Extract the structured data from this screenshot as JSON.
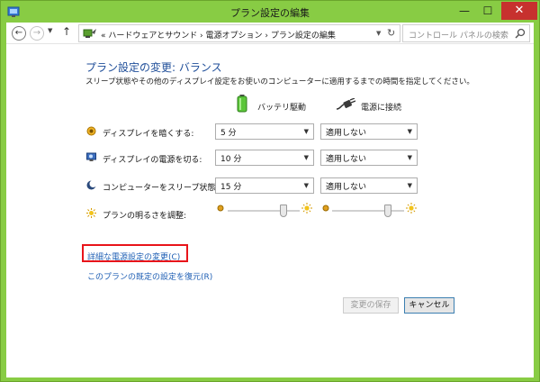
{
  "window": {
    "title": "プラン設定の編集",
    "controls": {
      "minimize": "—",
      "maximize": "☐",
      "close": "✕"
    }
  },
  "toolbar": {
    "address_path": "« ハードウェアとサウンド › 電源オプション › プラン設定の編集",
    "search_placeholder": "コントロール パネルの検索"
  },
  "main": {
    "heading": "プラン設定の変更: バランス",
    "description": "スリープ状態やその他のディスプレイ設定をお使いのコンピューターに適用するまでの時間を指定してください。",
    "columns": {
      "battery": "バッテリ駆動",
      "plugged": "電源に接続"
    },
    "rows": [
      {
        "label": "ディスプレイを暗くする:",
        "battery": "5 分",
        "plugged": "適用しない",
        "icon": "dim-display-icon"
      },
      {
        "label": "ディスプレイの電源を切る:",
        "battery": "10 分",
        "plugged": "適用しない",
        "icon": "display-off-icon"
      },
      {
        "label": "コンピューターをスリープ状態にする:",
        "battery": "15 分",
        "plugged": "適用しない",
        "icon": "sleep-moon-icon"
      }
    ],
    "brightness": {
      "label": "プランの明るさを調整:",
      "battery_level": 0.8,
      "plugged_level": 0.8
    },
    "links": {
      "advanced": "詳細な電源設定の変更(C)",
      "restore": "このプランの既定の設定を復元(R)"
    },
    "buttons": {
      "save": "変更の保存",
      "cancel": "キャンセル"
    }
  },
  "colors": {
    "frame": "#88cc44",
    "link": "#1f5fb4",
    "heading": "#1f4e99",
    "highlight": "#e8141a"
  }
}
